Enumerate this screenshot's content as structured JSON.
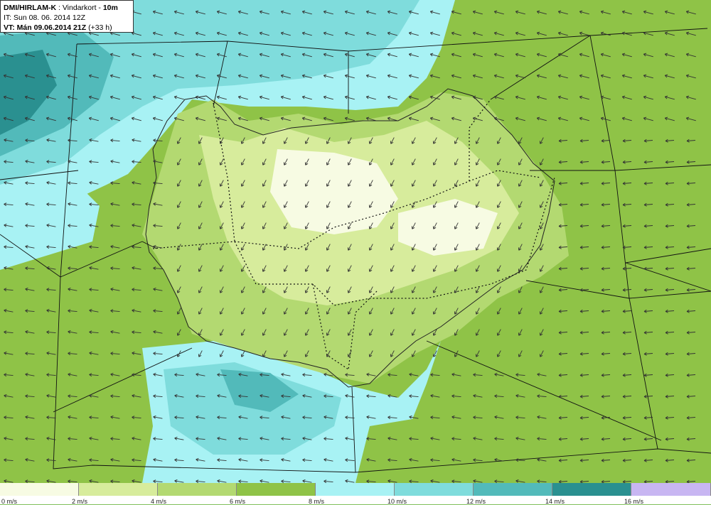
{
  "header": {
    "model": "DMI/HIRLAM-K",
    "sep": " : ",
    "product": "Vindarkort - ",
    "level": "10m",
    "it_label": "IT: ",
    "it_value": "Sun 08. 06. 2014 12Z",
    "vt_label": "VT: ",
    "vt_value": "Mán 09.06.2014 21Z",
    "vt_lead": " (+33 h)"
  },
  "legend": {
    "colors": [
      "#f7fbe3",
      "#d7ec9c",
      "#b3d971",
      "#8fc347",
      "#a8f2f4",
      "#7fdcdc",
      "#52baba",
      "#2a9090",
      "#c8b6f2"
    ],
    "ticks": [
      "0 m/s",
      "2 m/s",
      "4 m/s",
      "6 m/s",
      "8 m/s",
      "10 m/s",
      "12 m/s",
      "14 m/s",
      "16 m/s"
    ]
  },
  "wind": {
    "prevailing_direction": "northeast"
  }
}
